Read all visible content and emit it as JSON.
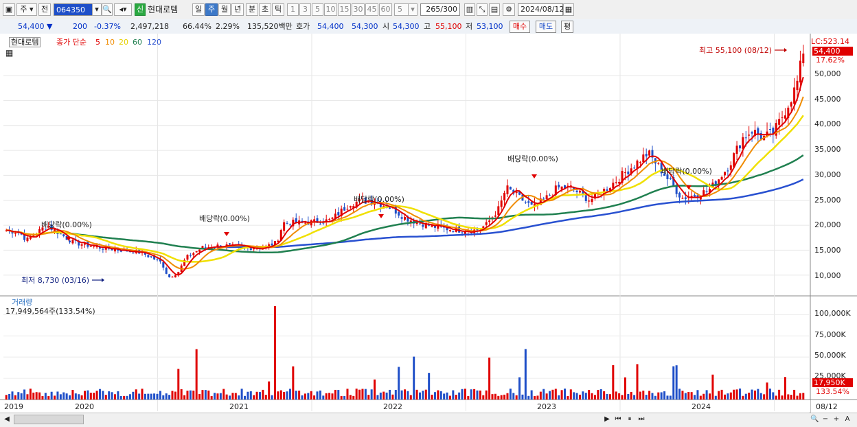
{
  "toolbar": {
    "period_type": "주",
    "prev_label": "전",
    "code": "064350",
    "new_badge": "신",
    "stock_name": "현대로템",
    "periods": [
      "일",
      "주",
      "월",
      "년",
      "분",
      "초",
      "틱"
    ],
    "selected_period": "주",
    "intervals": [
      "1",
      "3",
      "5",
      "10",
      "15",
      "30",
      "45",
      "60"
    ],
    "interval_select": "5",
    "count": "265",
    "count_total": "/300",
    "date": "2024/08/12"
  },
  "quote": {
    "price": "54,400",
    "change": "200",
    "change_pct": "-0.37%",
    "volume": "2,497,218",
    "volume_ratio": "66.44%",
    "turnover": "2.29%",
    "amount": "135,520백만",
    "ask_label": "호가",
    "ask1": "54,400",
    "ask2": "54,300",
    "open_label": "시",
    "open": "54,300",
    "high_label": "고",
    "high": "55,100",
    "low_label": "저",
    "low": "53,100",
    "buy_label": "매수",
    "sell_label": "매도",
    "eval_label": "평"
  },
  "chart_legend": {
    "name": "현대로템",
    "ma_label": "종가 단순",
    "ma_periods": [
      "5",
      "10",
      "20",
      "60",
      "120"
    ],
    "lc": "LC:523.14"
  },
  "price_axis": {
    "ticks": [
      "50,000",
      "45,000",
      "40,000",
      "35,000",
      "30,000",
      "25,000",
      "20,000",
      "15,000",
      "10,000"
    ],
    "current_price_tag": "54,400",
    "current_pct_tag": "17.62%"
  },
  "annotations": {
    "high": "최고 55,100 (08/12)",
    "low": "최저 8,730 (03/16)",
    "dividend": "배당락(0.00%)"
  },
  "volume_pane": {
    "title": "거래량",
    "value": "17,949,564주(133.54%)",
    "ticks": [
      "100,000K",
      "75,000K",
      "50,000K",
      "25,000K"
    ],
    "current_tag": "17,950K",
    "current_pct": "133.54%"
  },
  "date_axis": {
    "labels": [
      "2019",
      "2020",
      "2021",
      "2022",
      "2023",
      "2024"
    ],
    "right_label": "08/12"
  },
  "colors": {
    "up": "#e00000",
    "down": "#1f4fc8",
    "ma5": "#e00000",
    "ma10": "#f08c00",
    "ma20": "#f0e000",
    "ma60": "#208050",
    "ma120": "#2850d0"
  },
  "chart_data": {
    "type": "candlestick",
    "period": "weekly",
    "x_range": [
      "2019",
      "2024/08/12"
    ],
    "ylim": [
      7000,
      57000
    ],
    "close_trend": [
      [
        2019.0,
        19000
      ],
      [
        2019.1,
        18500
      ],
      [
        2019.15,
        17000
      ],
      [
        2019.3,
        20000
      ],
      [
        2019.5,
        16500
      ],
      [
        2019.7,
        15500
      ],
      [
        2019.85,
        15000
      ],
      [
        2020.0,
        14500
      ],
      [
        2020.15,
        12500
      ],
      [
        2020.2,
        9500
      ],
      [
        2020.27,
        10500
      ],
      [
        2020.33,
        13500
      ],
      [
        2020.45,
        15500
      ],
      [
        2020.6,
        16000
      ],
      [
        2020.75,
        15500
      ],
      [
        2020.9,
        15500
      ],
      [
        2021.0,
        16500
      ],
      [
        2021.05,
        20500
      ],
      [
        2021.2,
        20500
      ],
      [
        2021.4,
        21000
      ],
      [
        2021.55,
        24500
      ],
      [
        2021.7,
        25000
      ],
      [
        2021.85,
        23500
      ],
      [
        2021.95,
        21500
      ],
      [
        2022.05,
        20500
      ],
      [
        2022.2,
        19500
      ],
      [
        2022.35,
        19000
      ],
      [
        2022.48,
        19000
      ],
      [
        2022.55,
        20000
      ],
      [
        2022.65,
        23500
      ],
      [
        2022.7,
        27500
      ],
      [
        2022.8,
        25500
      ],
      [
        2022.9,
        23500
      ],
      [
        2023.0,
        25500
      ],
      [
        2023.08,
        27500
      ],
      [
        2023.18,
        27500
      ],
      [
        2023.32,
        25000
      ],
      [
        2023.45,
        27500
      ],
      [
        2023.6,
        31000
      ],
      [
        2023.75,
        34500
      ],
      [
        2023.85,
        31000
      ],
      [
        2024.0,
        25500
      ],
      [
        2024.1,
        26000
      ],
      [
        2024.2,
        27000
      ],
      [
        2024.25,
        28500
      ],
      [
        2024.35,
        32000
      ],
      [
        2024.45,
        37500
      ],
      [
        2024.52,
        39000
      ],
      [
        2024.6,
        37500
      ],
      [
        2024.68,
        38500
      ],
      [
        2024.72,
        40500
      ],
      [
        2024.8,
        45000
      ],
      [
        2024.85,
        48000
      ],
      [
        2024.9,
        54400
      ]
    ],
    "high": {
      "value": 55100,
      "date": "08/12"
    },
    "low": {
      "value": 8730,
      "date": "03/16"
    },
    "moving_averages": [
      "5",
      "10",
      "20",
      "60",
      "120"
    ],
    "volume_peak_k": 110000,
    "volume_latest_k": 17950
  }
}
